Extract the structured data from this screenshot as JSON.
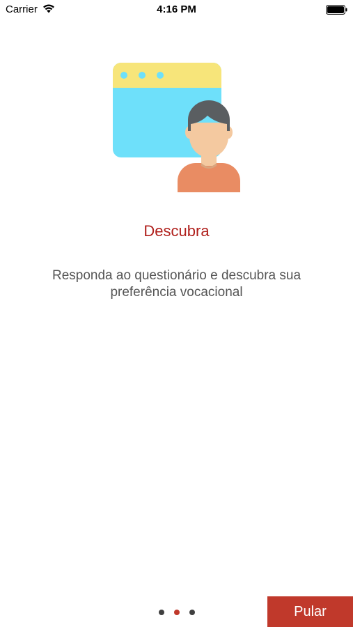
{
  "status_bar": {
    "carrier": "Carrier",
    "time": "4:16 PM",
    "icons": [
      "wifi-icon",
      "battery-icon"
    ]
  },
  "onboarding": {
    "illustration": "browser-window-with-user-illustration",
    "title": "Descubra",
    "description": "Responda ao questionário e descubra sua preferência vocacional",
    "page_count": 3,
    "current_page": 2
  },
  "skip_button": {
    "label": "Pular"
  },
  "colors": {
    "accent": "#c0392b",
    "title": "#b0201c",
    "body_text": "#555555",
    "window_top": "#f7e57a",
    "window_body": "#6ee0fa",
    "window_dots": "#6ee0fa",
    "hair": "#5a5e61",
    "skin": "#f4c9a0",
    "shirt": "#e98c63"
  }
}
